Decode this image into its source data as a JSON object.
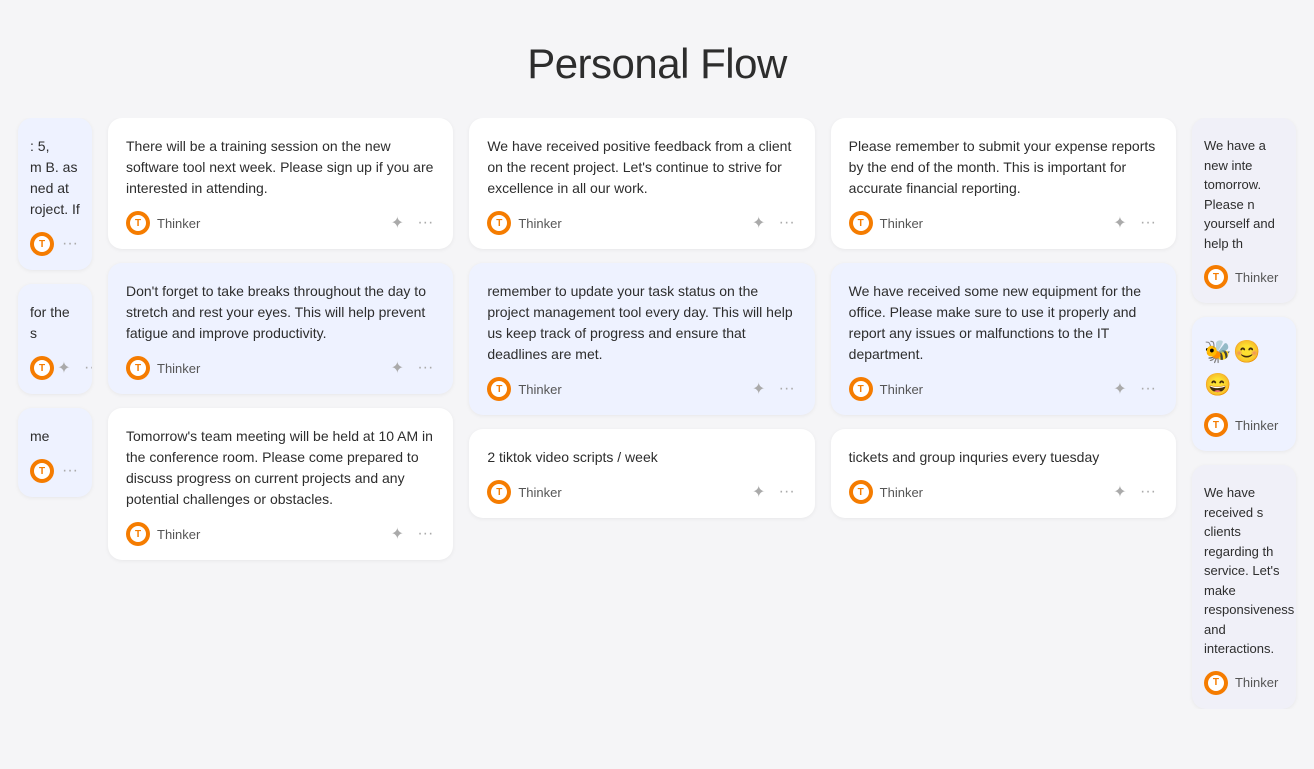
{
  "page": {
    "title": "Personal Flow"
  },
  "columns": [
    {
      "id": "col-left-partial",
      "partial": true,
      "cards": [
        {
          "id": "card-lp1",
          "text": ": 5, m B. as ned at roject. If",
          "author": "Thinker",
          "partial": true
        },
        {
          "id": "card-lp2",
          "text": "for the s",
          "author": "Thinker",
          "partial": true
        },
        {
          "id": "card-lp3",
          "text": "me",
          "author": "Thinker",
          "partial": true
        }
      ]
    },
    {
      "id": "col-1",
      "cards": [
        {
          "id": "card-1",
          "text": "There will be a training session on the new software tool next week. Please sign up if you are interested in attending.",
          "author": "Thinker"
        },
        {
          "id": "card-2",
          "text": "Don't forget to take breaks throughout the day to stretch and rest your eyes. This will help prevent fatigue and improve productivity.",
          "author": "Thinker"
        },
        {
          "id": "card-3",
          "text": "Tomorrow's team meeting will be held at 10 AM in the conference room. Please come prepared to discuss progress on current projects and any potential challenges or obstacles.",
          "author": "Thinker"
        }
      ]
    },
    {
      "id": "col-2",
      "cards": [
        {
          "id": "card-4",
          "text": "We have received positive feedback from a client on the recent project. Let's continue to strive for excellence in all our work.",
          "author": "Thinker"
        },
        {
          "id": "card-5",
          "text": "remember to update your task status on the project management tool every day. This will help us keep track of progress and ensure that deadlines are met.",
          "author": "Thinker"
        },
        {
          "id": "card-6",
          "text": "2 tiktok video scripts / week",
          "author": "Thinker"
        }
      ]
    },
    {
      "id": "col-3",
      "cards": [
        {
          "id": "card-7",
          "text": "Please remember to submit your expense reports by the end of the month. This is important for accurate financial reporting.",
          "author": "Thinker"
        },
        {
          "id": "card-8",
          "text": "We have received some new equipment for the office. Please make sure to use it properly and report any issues or malfunctions to the IT department.",
          "author": "Thinker"
        },
        {
          "id": "card-9",
          "text": "tickets and group inquries every tuesday",
          "author": "Thinker"
        }
      ]
    },
    {
      "id": "col-right-partial",
      "partial": true,
      "cards": [
        {
          "id": "card-rp1",
          "text": "We have a new inte tomorrow. Please n yourself and help th",
          "author": "Thinker",
          "partial": true
        },
        {
          "id": "card-rp2",
          "text": "🐝😊😄",
          "author": "Thinker",
          "partial": true,
          "emoji": true
        },
        {
          "id": "card-rp3",
          "text": "We have received s clients regarding th service. Let's make responsiveness and interactions.",
          "author": "Thinker",
          "partial": true
        }
      ]
    }
  ],
  "labels": {
    "pin_icon": "✦",
    "more_icon": "···",
    "author": "Thinker"
  }
}
